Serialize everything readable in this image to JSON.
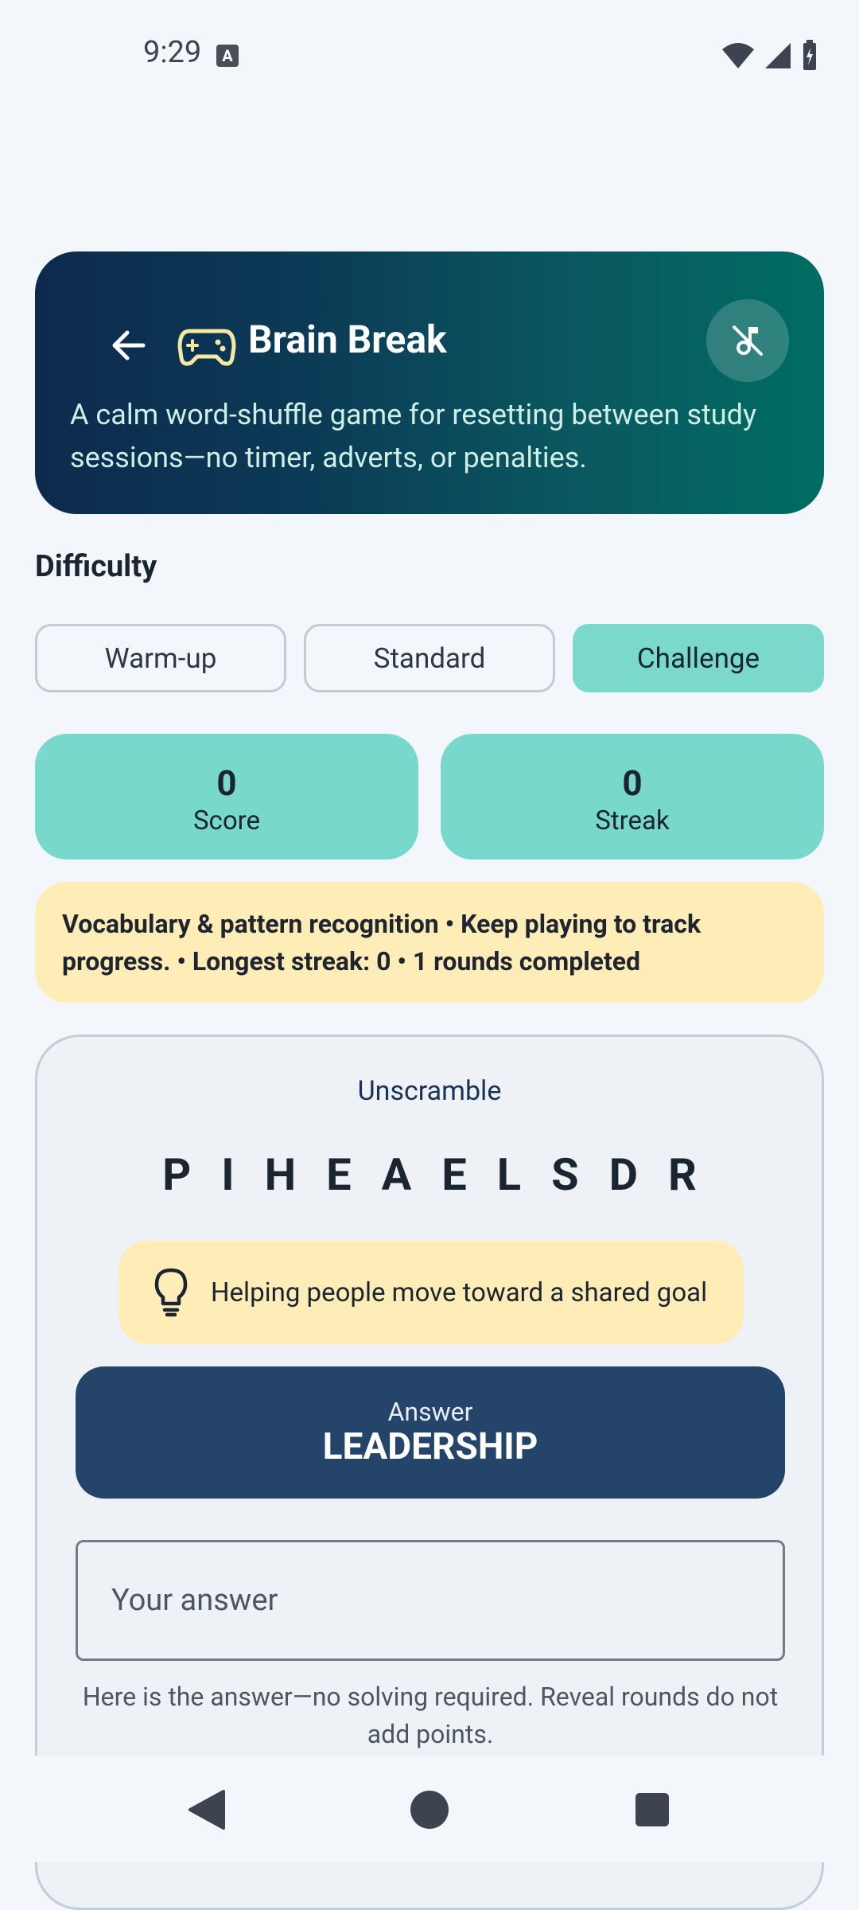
{
  "status_bar": {
    "time": "9:29",
    "notification_icon": "A",
    "icons": [
      "wifi-icon",
      "cell-signal-icon",
      "battery-charging-icon"
    ]
  },
  "header": {
    "title": "Brain Break",
    "description": "A calm word-shuffle game for resetting between study sessions—no timer, adverts, or penalties.",
    "back_icon": "arrow-back-icon",
    "game_icon": "gamepad-icon",
    "sound_icon": "music-off-icon",
    "gradient_colors": [
      "#0d2a4d",
      "#006c62"
    ]
  },
  "difficulty": {
    "label": "Difficulty",
    "options": [
      "Warm-up",
      "Standard",
      "Challenge"
    ],
    "selected": "Challenge"
  },
  "stats": {
    "score": {
      "value": "0",
      "label": "Score"
    },
    "streak": {
      "value": "0",
      "label": "Streak"
    }
  },
  "info_text": "Vocabulary & pattern recognition • Keep playing to track progress. • Longest streak: 0 • 1 rounds completed",
  "game": {
    "prompt_label": "Unscramble",
    "scrambled": "PIHEAELSDR",
    "hint": "Helping people move toward a shared goal",
    "answer_label": "Answer",
    "answer_value": "LEADERSHIP",
    "input_placeholder": "Your answer",
    "input_value": "",
    "note": "Here is the answer—no solving required. Reveal rounds do not add points."
  },
  "colors": {
    "accent_teal": "#7ad8cc",
    "hint_yellow": "#feedb6",
    "answer_navy": "#24446a"
  },
  "nav_bar": [
    "back-triangle-icon",
    "home-circle-icon",
    "recents-square-icon"
  ]
}
